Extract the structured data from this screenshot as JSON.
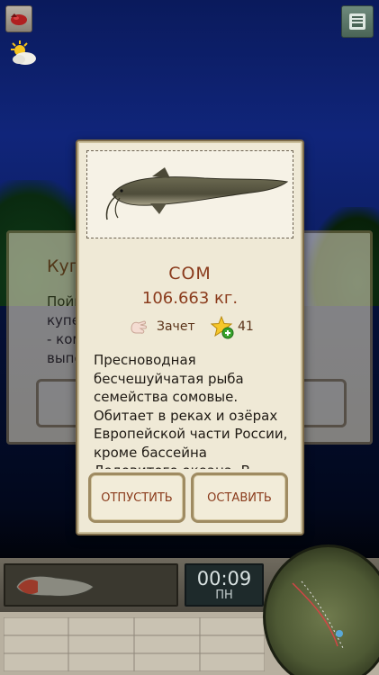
{
  "catch_card": {
    "fish_name": "СОМ",
    "fish_weight": "106.663 кг.",
    "trophy_label": "Зачет",
    "points": "41",
    "description": "Пресноводная бесчешуйчатая рыба семейства сомовые. Обитает в реках и озёрах Европейской части России, кроме бассейна Ледовитого океана. В",
    "release_button": "ОТПУСТИТЬ",
    "keep_button": "ОСТАВИТЬ"
  },
  "background_dialog": {
    "title": "Куп",
    "text_lines": [
      "Пойм",
      "купе",
      "- ком",
      "выпо"
    ]
  },
  "hud": {
    "clock_time": "00:09",
    "clock_day": "ПН"
  },
  "colors": {
    "accent_text": "#8a3b1c",
    "card_bg": "#efe9d6",
    "card_border": "#7d6b48"
  },
  "icons": {
    "top_left": "bait-box-icon",
    "weather": "sun-cloud-icon",
    "top_right": "menu-icon",
    "trophy": "hand-icon",
    "points": "star-plus-icon"
  }
}
